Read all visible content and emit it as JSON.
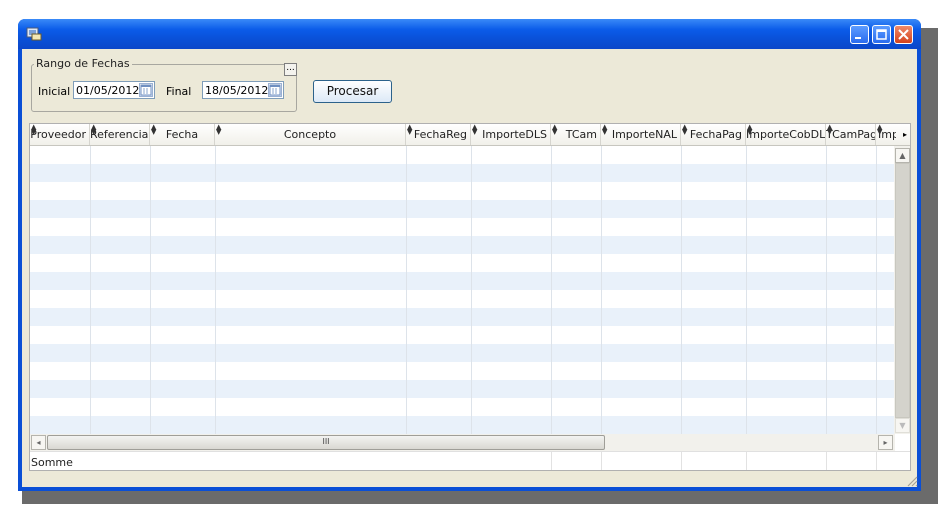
{
  "window": {
    "title": ""
  },
  "filter": {
    "legend": "Rango de Fechas",
    "ellipsis_label": "...",
    "start_label": "Inicial",
    "start_value": "01/05/2012",
    "end_label": "Final",
    "end_value": "18/05/2012",
    "process_button": "Procesar"
  },
  "grid": {
    "columns": [
      "Proveedor",
      "Referencia",
      "Fecha",
      "Concepto",
      "FechaReg",
      "ImporteDLS",
      "TCam",
      "ImporteNAL",
      "FechaPag",
      "ImporteCobDLS",
      "TCamPag",
      "Imp"
    ],
    "footer_text": "Somme",
    "hscroll_grip": "III"
  },
  "colors": {
    "titlebar": "#0a4fd6",
    "client_bg": "#ece9d8",
    "alt_row": "#e9f1fa"
  }
}
